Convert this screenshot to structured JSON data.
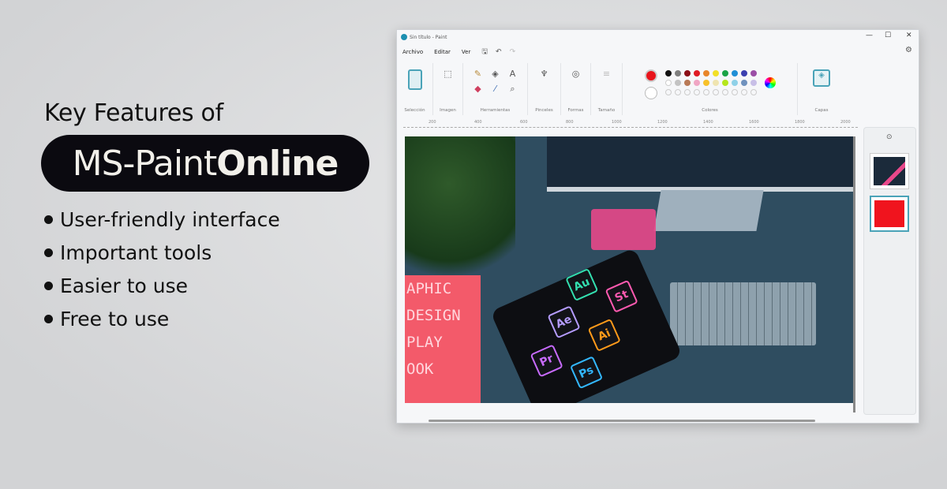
{
  "headline": {
    "line1": "Key Features of",
    "brand_regular": "MS-Paint",
    "brand_bold": "Online"
  },
  "features": [
    "User-friendly interface",
    "Important tools",
    "Easier to use",
    "Free to use"
  ],
  "window": {
    "title": "Sin título - Paint",
    "controls": {
      "minimize": "—",
      "maximize": "☐",
      "close": "✕"
    },
    "menu": [
      "Archivo",
      "Editar",
      "Ver"
    ],
    "toolbar_icons": [
      "save-icon",
      "undo-icon",
      "redo-icon"
    ],
    "settings_icon": "gear-icon",
    "ribbon_groups": [
      "Selección",
      "Imagen",
      "Herramientas",
      "Pinceles",
      "Formas",
      "Tamaño",
      "Colores",
      "Capas"
    ],
    "primary_color": "#e8141c",
    "secondary_color": "#ffffff",
    "palette_row1": [
      "#111111",
      "#7f7f7f",
      "#8b0e16",
      "#e01b24",
      "#e8862a",
      "#f2e027",
      "#1aa346",
      "#1f8fd6",
      "#3b3fb0",
      "#9b4ea6"
    ],
    "palette_row2": [
      "#ffffff",
      "#c3c3c3",
      "#b97a57",
      "#f0a6c4",
      "#f7c12a",
      "#efe4b0",
      "#b5e61d",
      "#8fd1e8",
      "#7092be",
      "#c8bfe7"
    ],
    "ruler_ticks": [
      "200",
      "400",
      "600",
      "800",
      "1000",
      "1200",
      "1400",
      "1600",
      "1800",
      "2000"
    ],
    "canvas_app_icons": [
      "Pr",
      "Ae",
      "Au",
      "Ps",
      "Ai",
      "St"
    ],
    "notebook_text": [
      "APHIC",
      "DESIGN",
      "PLAY",
      "OOK"
    ],
    "layer_colors": [
      "#1b2a3a",
      "#f0141e"
    ]
  }
}
